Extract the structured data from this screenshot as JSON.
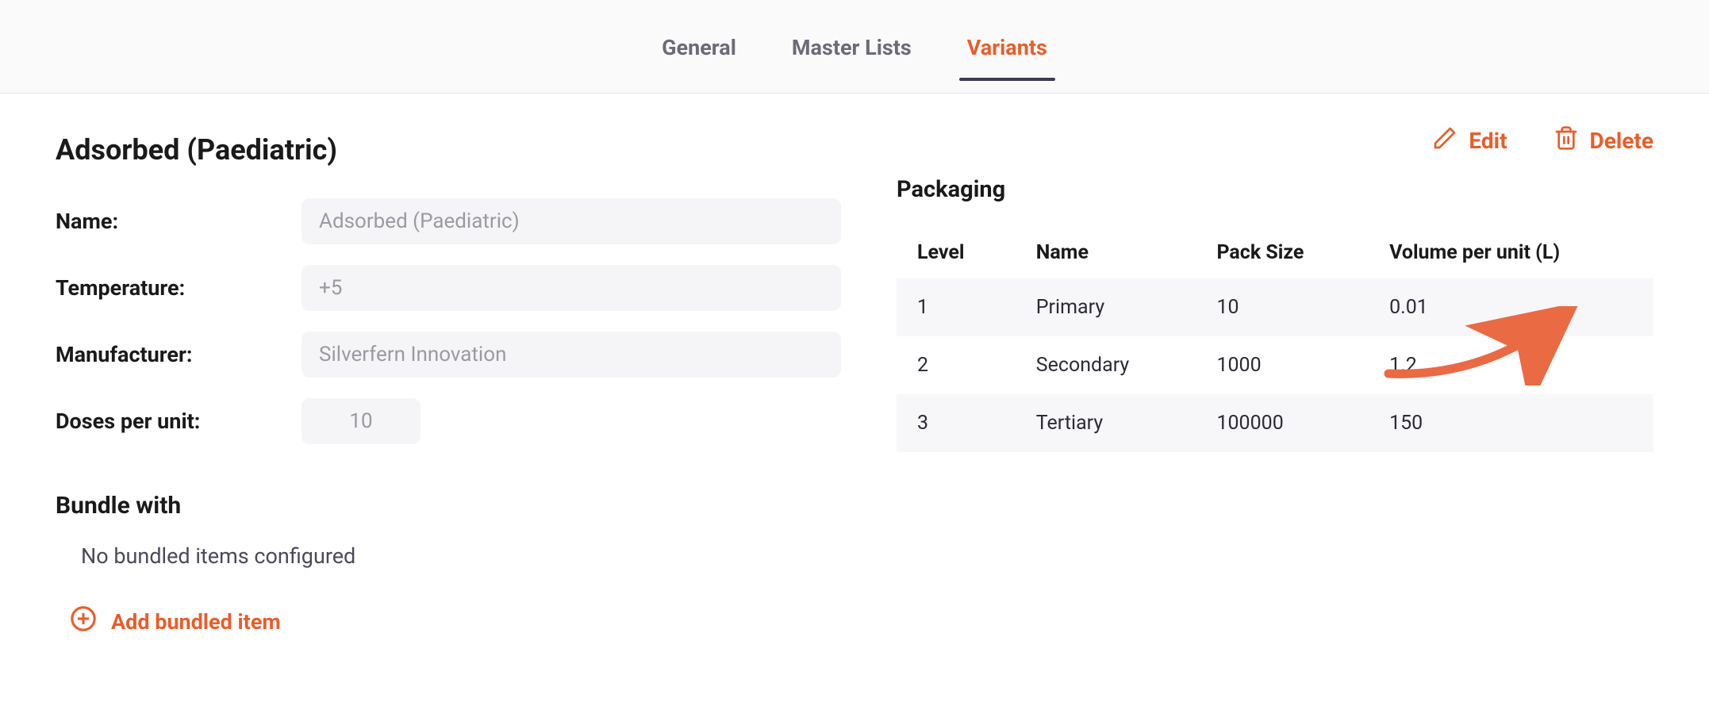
{
  "tabs": {
    "general": "General",
    "master_lists": "Master Lists",
    "variants": "Variants"
  },
  "title": "Adsorbed (Paediatric)",
  "form": {
    "name_label": "Name:",
    "name_value": "Adsorbed (Paediatric)",
    "temperature_label": "Temperature:",
    "temperature_value": "+5",
    "manufacturer_label": "Manufacturer:",
    "manufacturer_value": "Silverfern Innovation",
    "doses_label": "Doses per unit:",
    "doses_value": "10"
  },
  "bundle": {
    "heading": "Bundle with",
    "empty_text": "No bundled items configured",
    "add_label": "Add bundled item"
  },
  "actions": {
    "edit": "Edit",
    "delete": "Delete"
  },
  "packaging": {
    "heading": "Packaging",
    "columns": {
      "level": "Level",
      "name": "Name",
      "pack_size": "Pack Size",
      "volume": "Volume per unit (L)"
    },
    "rows": [
      {
        "level": "1",
        "name": "Primary",
        "pack_size": "10",
        "volume": "0.01"
      },
      {
        "level": "2",
        "name": "Secondary",
        "pack_size": "1000",
        "volume": "1.2"
      },
      {
        "level": "3",
        "name": "Tertiary",
        "pack_size": "100000",
        "volume": "150"
      }
    ]
  }
}
